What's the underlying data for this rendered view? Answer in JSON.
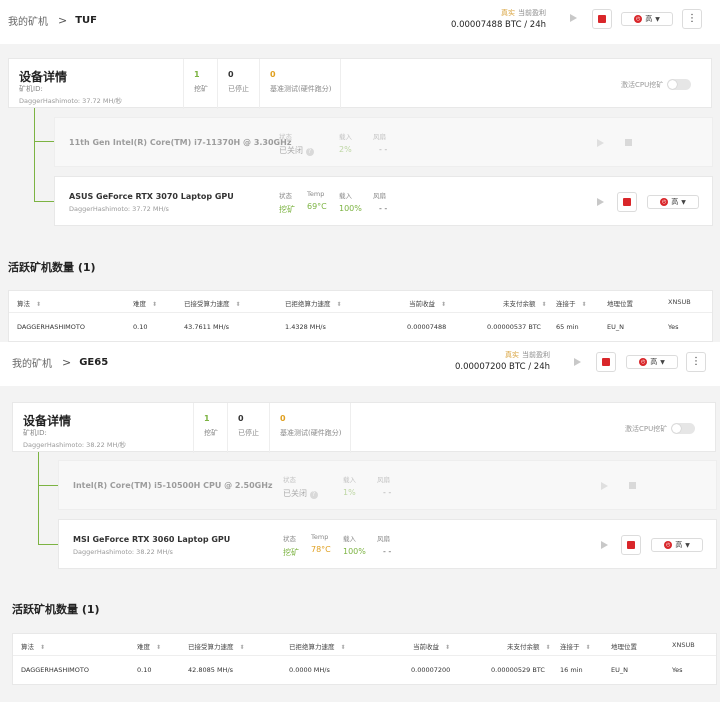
{
  "rigs": [
    {
      "breadcrumb_root": "我的矿机",
      "rig_name": "TUF",
      "profit_live": "真实",
      "profit_label": "当前盈利",
      "profit_value": "0.00007488 BTC / 24h",
      "mode_label": "高",
      "device": {
        "title": "设备详情",
        "id_label": "矿机ID:",
        "algo": "DaggerHashimoto: 37.72 MH/秒",
        "mining_count": "1",
        "mining_label": "挖矿",
        "stopped_count": "0",
        "stopped_label": "已停止",
        "bench_count": "0",
        "bench_label": "基准测试(硬件跑分)",
        "cpu_toggle_label": "激活CPU挖矿"
      },
      "components": [
        {
          "name": "11th Gen Intel(R) Core(TM) i7-11370H @ 3.30GHz",
          "sub": "",
          "status_h": "状态",
          "status_v": "已关闭",
          "temp_h": "",
          "temp_v": "",
          "load_h": "载入",
          "load_v": "2%",
          "fan_h": "风扇",
          "fan_v": "- -"
        },
        {
          "name": "ASUS GeForce RTX 3070 Laptop GPU",
          "sub": "DaggerHashimoto: 37.72 MH/s",
          "status_h": "状态",
          "status_v": "挖矿",
          "temp_h": "Temp",
          "temp_v": "69°C",
          "load_h": "载入",
          "load_v": "100%",
          "fan_h": "风扇",
          "fan_v": "- -"
        }
      ],
      "active_title": "活跃矿机数量 (1)",
      "table": {
        "headers": [
          "算法",
          "难度",
          "已接受算力速度",
          "已拒绝算力速度",
          "当前收益",
          "未支付余额",
          "连接于",
          "地理位置",
          "XNSUB"
        ],
        "row": [
          "DAGGERHASHIMOTO",
          "0.10",
          "43.7611 MH/s",
          "1.4328 MH/s",
          "0.00007488",
          "0.00000537 BTC",
          "65 min",
          "EU_N",
          "Yes"
        ]
      }
    },
    {
      "breadcrumb_root": "我的矿机",
      "rig_name": "GE65",
      "profit_live": "真实",
      "profit_label": "当前盈利",
      "profit_value": "0.00007200 BTC / 24h",
      "mode_label": "高",
      "device": {
        "title": "设备详情",
        "id_label": "矿机ID:",
        "algo": "DaggerHashimoto: 38.22 MH/秒",
        "mining_count": "1",
        "mining_label": "挖矿",
        "stopped_count": "0",
        "stopped_label": "已停止",
        "bench_count": "0",
        "bench_label": "基准测试(硬件跑分)",
        "cpu_toggle_label": "激活CPU挖矿"
      },
      "components": [
        {
          "name": "Intel(R) Core(TM) i5-10500H CPU @ 2.50GHz",
          "sub": "",
          "status_h": "状态",
          "status_v": "已关闭",
          "temp_h": "",
          "temp_v": "",
          "load_h": "载入",
          "load_v": "1%",
          "fan_h": "风扇",
          "fan_v": "- -"
        },
        {
          "name": "MSI GeForce RTX 3060 Laptop GPU",
          "sub": "DaggerHashimoto: 38.22 MH/s",
          "status_h": "状态",
          "status_v": "挖矿",
          "temp_h": "Temp",
          "temp_v": "78°C",
          "load_h": "载入",
          "load_v": "100%",
          "fan_h": "风扇",
          "fan_v": "- -"
        }
      ],
      "active_title": "活跃矿机数量 (1)",
      "table": {
        "headers": [
          "算法",
          "难度",
          "已接受算力速度",
          "已拒绝算力速度",
          "当前收益",
          "未支付余额",
          "连接于",
          "地理位置",
          "XNSUB"
        ],
        "row": [
          "DAGGERHASHIMOTO",
          "0.10",
          "42.8085 MH/s",
          "0.0000 MH/s",
          "0.00007200",
          "0.00000529 BTC",
          "16 min",
          "EU_N",
          "Yes"
        ]
      }
    }
  ]
}
